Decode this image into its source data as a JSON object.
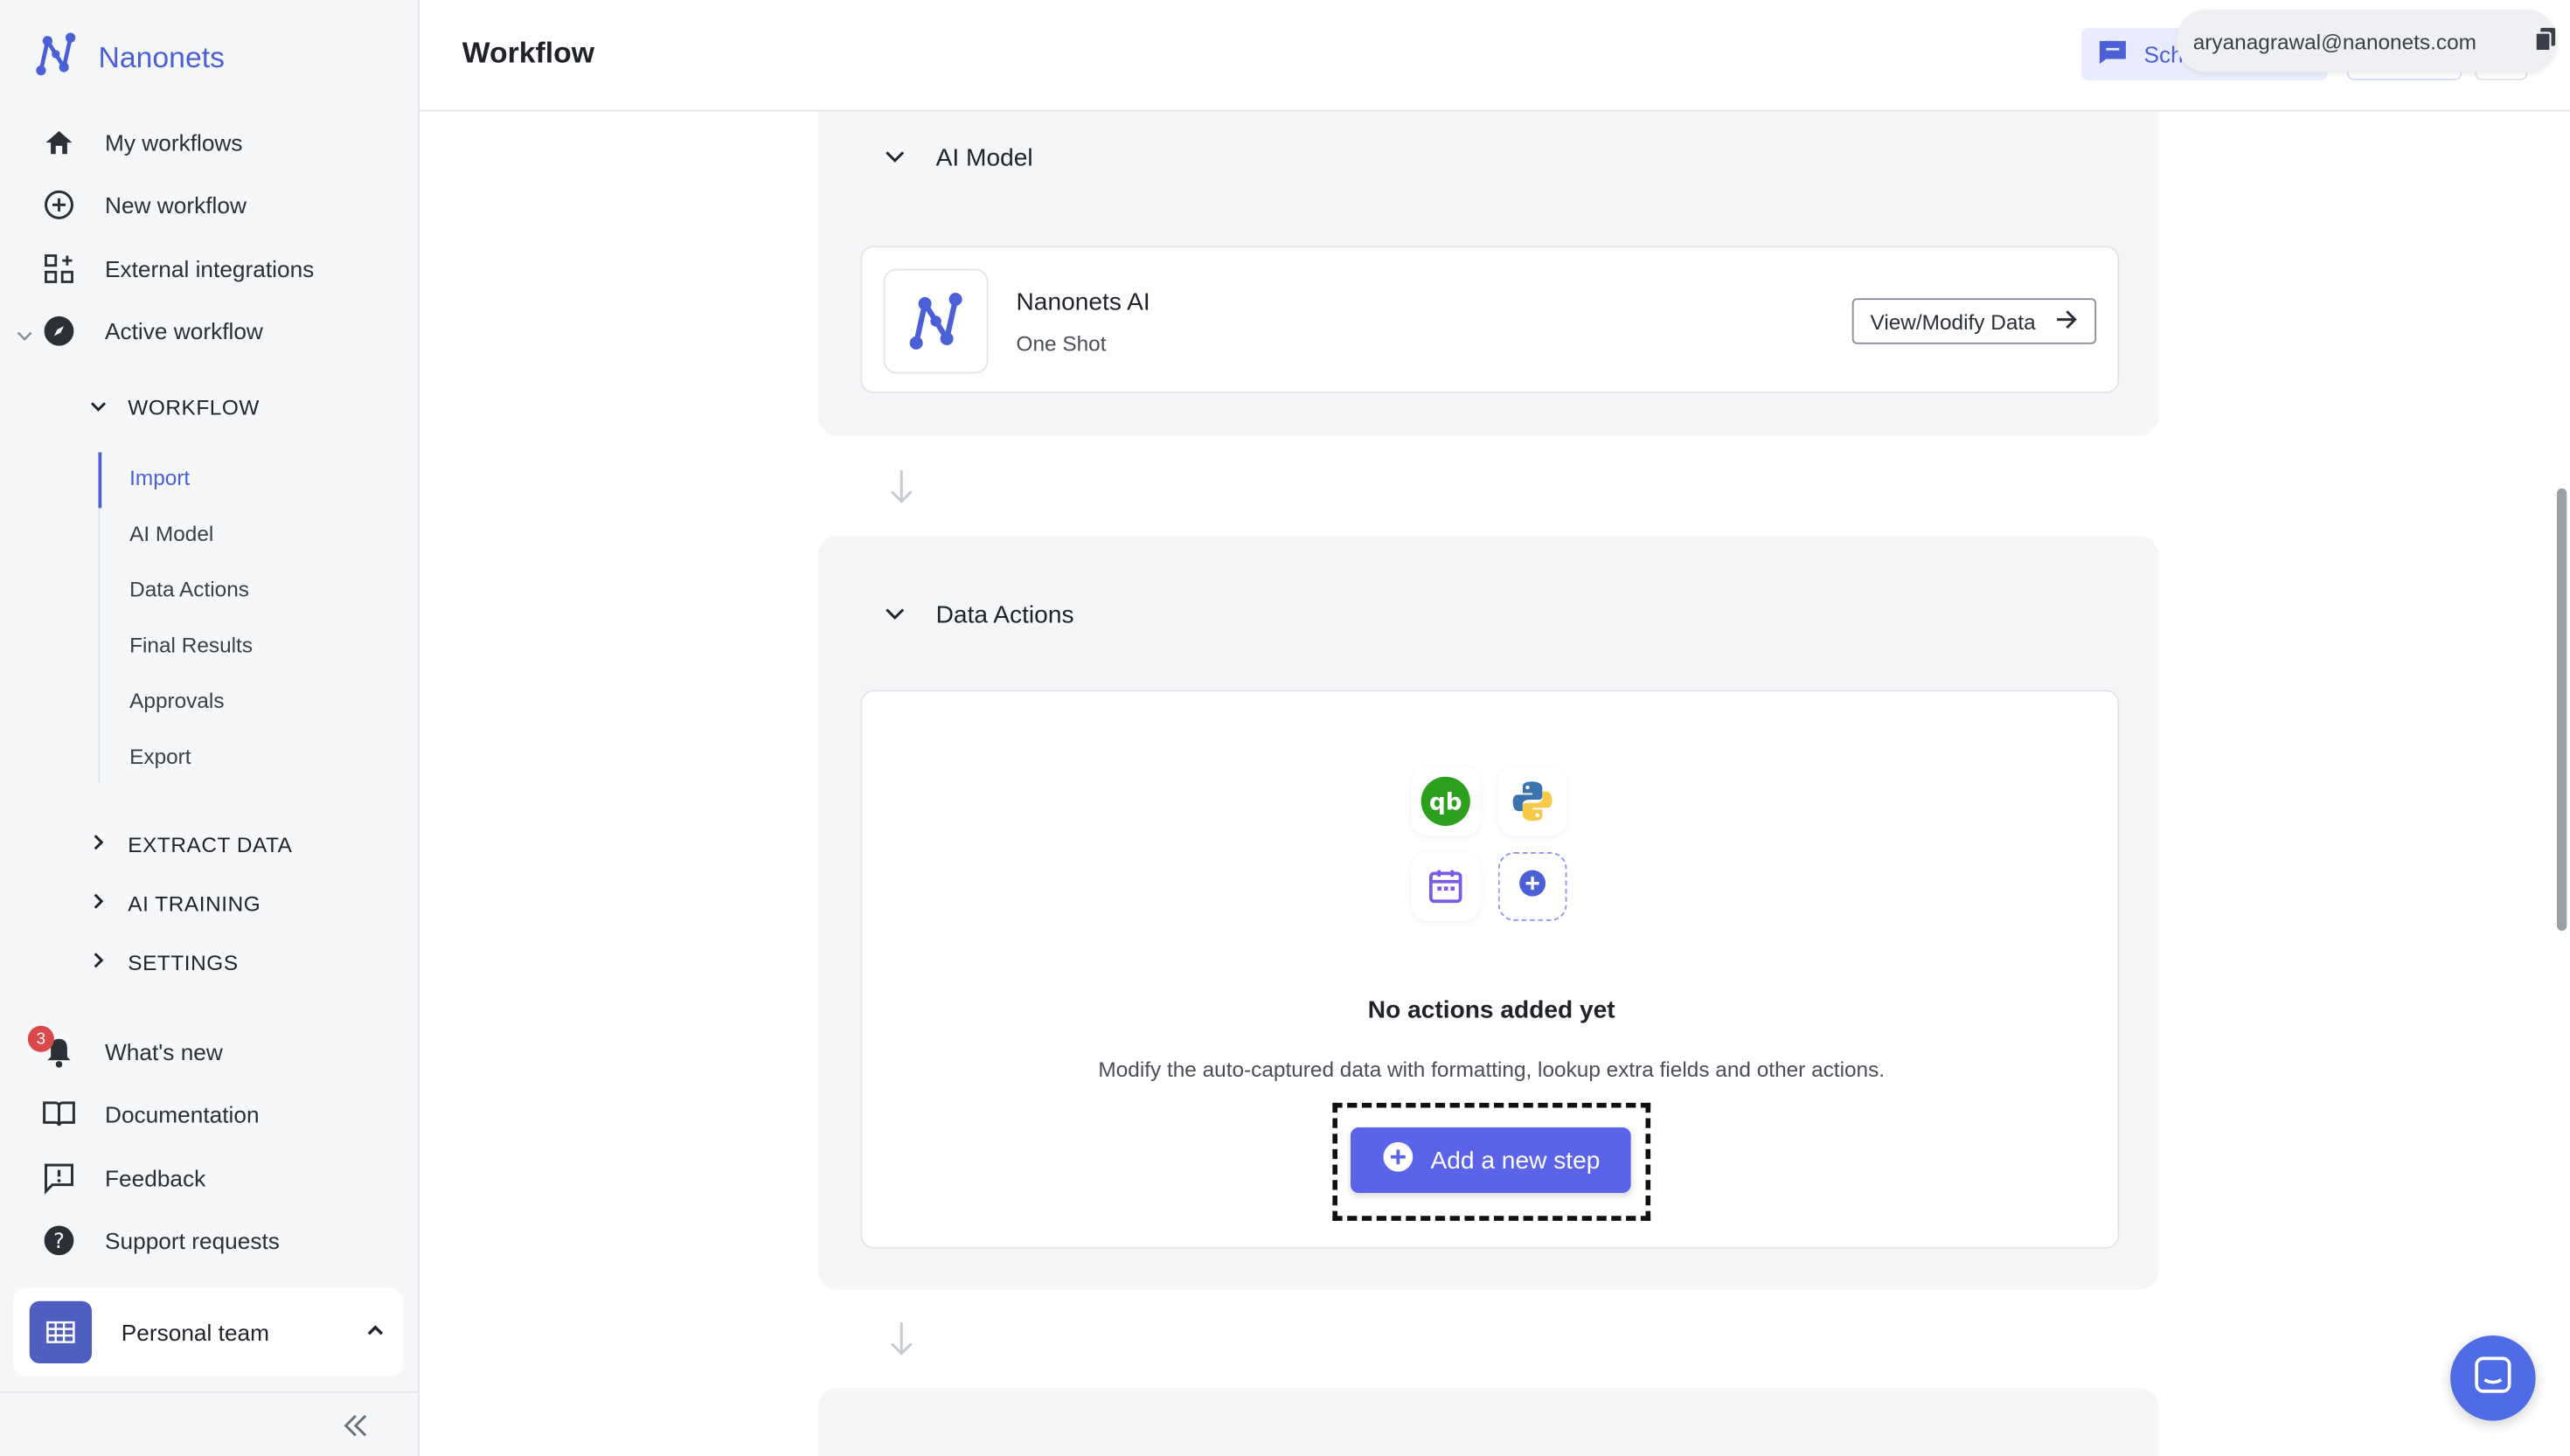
{
  "brand": {
    "name": "Nanonets"
  },
  "sidebar": {
    "nav": [
      {
        "label": "My workflows",
        "icon": "home-icon"
      },
      {
        "label": "New workflow",
        "icon": "plus-circle-icon"
      },
      {
        "label": "External integrations",
        "icon": "grid-plus-icon"
      },
      {
        "label": "Active workflow",
        "icon": "compass-icon"
      }
    ],
    "sections": {
      "workflow": "WORKFLOW",
      "extract_data": "EXTRACT DATA",
      "ai_training": "AI TRAINING",
      "settings": "SETTINGS"
    },
    "workflow_items": [
      "Import",
      "AI Model",
      "Data Actions",
      "Final Results",
      "Approvals",
      "Export"
    ],
    "bottom_nav": [
      {
        "label": "What's new",
        "icon": "bell-icon"
      },
      {
        "label": "Documentation",
        "icon": "book-icon"
      },
      {
        "label": "Feedback",
        "icon": "feedback-icon"
      },
      {
        "label": "Support requests",
        "icon": "help-icon"
      }
    ],
    "notification_count": "3",
    "team": {
      "name": "Personal team"
    }
  },
  "header": {
    "title": "Workflow",
    "schedule_label": "Sch",
    "user_email": "aryanagrawal@nanonets.com"
  },
  "ai_model_panel": {
    "title": "AI Model",
    "model_name": "Nanonets AI",
    "model_sub": "One Shot",
    "view_button": "View/Modify Data"
  },
  "data_actions_panel": {
    "title": "Data Actions",
    "empty_title": "No actions added yet",
    "empty_sub": "Modify the auto-captured data with formatting, lookup extra fields and other actions.",
    "add_button": "Add a new step"
  },
  "colors": {
    "accent": "#4b5fd6",
    "button": "#5b63e8",
    "quickbooks": "#2ca01c",
    "badge": "#d9484b"
  }
}
